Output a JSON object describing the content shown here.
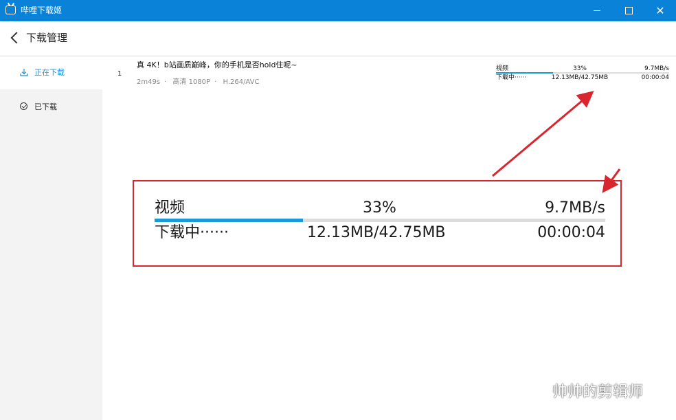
{
  "window": {
    "title": "哔哩下载姬"
  },
  "header": {
    "title": "下载管理"
  },
  "sidebar": {
    "items": [
      {
        "label": "正在下载",
        "active": true
      },
      {
        "label": "已下载",
        "active": false
      }
    ]
  },
  "download": {
    "index": "1",
    "title": "真 4K！b站画质巅峰，你的手机是否hold住呢~",
    "duration": "2m49s",
    "quality": "高清 1080P",
    "codec": "H.264/AVC",
    "separator": "·",
    "type_label": "视频",
    "percent_text": "33%",
    "progress": 0.33,
    "speed": "9.7MB/s",
    "status": "下载中······",
    "size": "12.13MB/42.75MB",
    "remaining": "00:00:04"
  },
  "zoom": {
    "type_label": "视频",
    "percent_text": "33%",
    "speed": "9.7MB/s",
    "status": "下载中······",
    "size": "12.13MB/42.75MB",
    "remaining": "00:00:04"
  },
  "watermark": {
    "text": "帅帅的剪辑师"
  },
  "colors": {
    "titlebar": "#0a82d8",
    "accent": "#1a9ad7",
    "highlight": "#d9252e"
  }
}
